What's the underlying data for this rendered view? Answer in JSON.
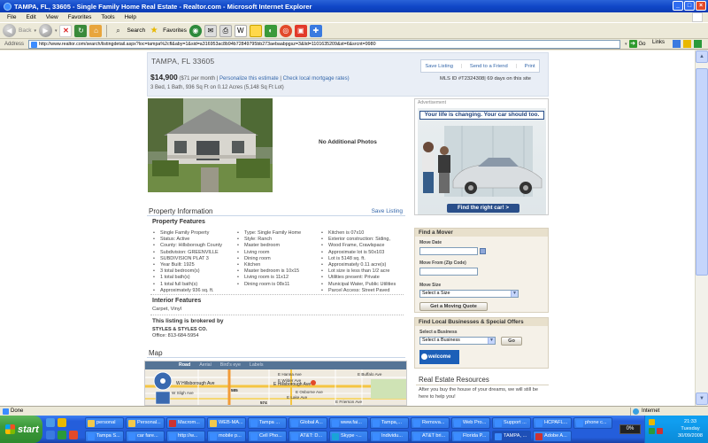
{
  "window": {
    "title": "TAMPA, FL, 33605 - Single Family Home Real Estate - Realtor.com - Microsoft Internet Explorer"
  },
  "menu": [
    "File",
    "Edit",
    "View",
    "Favorites",
    "Tools",
    "Help"
  ],
  "toolbar": {
    "back_label": "Back",
    "search_label": "Search",
    "favorites_label": "Favorites"
  },
  "address": {
    "label": "Address",
    "url": "http://www.realtor.com/search/listingdetail.aspx?loc=tampa%2cfl&aby=1&sid=a316953ac8b94b72849795bb273aebaabpgsz=3&lid=1101635209&st=6&srcnt=9980",
    "go_label": "Go",
    "links_label": "Links"
  },
  "listing": {
    "location": "TAMPA, FL 33605",
    "price": "$14,900",
    "per_month": "($71 per month |",
    "personalize_link": "Personalize this estimate",
    "sep": "|",
    "mortgage_link": "Check local mortgage rates)",
    "details": "3 Bed, 1 Bath, 936 Sq Ft on 0.12 Acres (5,148 Sq Ft Lot)",
    "actions": [
      "Save Listing",
      "Send to a Friend",
      "Print"
    ],
    "mls": "MLS ID #T2324308| 69 days on this site",
    "no_photos": "No Additional Photos"
  },
  "property_info": {
    "title": "Property Information",
    "save_link": "Save Listing",
    "features_title": "Property Features",
    "col1": [
      "Single Family Property",
      "Status: Active",
      "County: Hillsborough County",
      "Subdivision: GREENVILLE",
      "SUBDIVISION PLAT 3",
      "Year Built: 1925",
      "3 total bedroom(s)",
      "1 total bath(s)",
      "1 total full bath(s)",
      "Approximately 936 sq. ft."
    ],
    "col2": [
      "Type: Single Family Home",
      "Style: Ranch",
      "Master bedroom",
      "Living room",
      "Dining room",
      "Kitchen",
      "Master bedroom is 10x15",
      "Living room is 11x12",
      "Dining room is 08x11"
    ],
    "col3": [
      "Kitchen is 07x10",
      "Exterior construction: Siding,",
      "Wood Frame, Crawlspace",
      "Approximate lot is 50x103",
      "Lot is 5148 sq. ft.",
      "Approximately 0.11 acre(s)",
      "Lot size is less than 1/2 acre",
      "Utilities present: Private",
      "Municipal Water, Public Utilities",
      "Parcel Access: Street Paved"
    ],
    "interior_title": "Interior Features",
    "interior_value": "Carpet, Vinyl",
    "broker_title": "This listing is brokered by",
    "broker_name": "STYLES & STYLES CO.",
    "broker_office": "Office: 813-684-5954"
  },
  "map": {
    "title": "Map",
    "tabs": [
      "Road",
      "Aerial",
      "Bird's eye",
      "Labels"
    ],
    "labels": [
      "E Hanna Ave",
      "E Wilder Ave",
      "W Hillsborough Ave",
      "E Hillsborough Ave",
      "E Osborne Ave",
      "E Lake Ave",
      "W Sligh Ave",
      "E Frierson Ave",
      "E Buffalo Ave",
      "585",
      "574"
    ]
  },
  "ad": {
    "label": "Advertisement",
    "headline": "Your life is changing. Your car should too.",
    "button": "Find the right car! >"
  },
  "mover": {
    "title": "Find a Mover",
    "move_date_label": "Move Date",
    "move_from_label": "Move From (Zip Code)",
    "move_size_label": "Move Size",
    "move_size_value": "Select a Size",
    "quote_button": "Get a Moving Quote"
  },
  "local": {
    "title": "Find Local Businesses & Special Offers",
    "select_label": "Select a Business",
    "select_value": "Select a Business",
    "go_button": "Go",
    "welcome": "welcome wagon"
  },
  "resources": {
    "title": "Real Estate Resources",
    "text": "After you buy the house of your dreams, we will still be here to help you!"
  },
  "status": {
    "left": "Done",
    "zone": "Internet"
  },
  "taskbar": {
    "start": "start",
    "row1": [
      "personal",
      "Personal...",
      "Macrom...",
      "WEB-MA...",
      "Tampa ...",
      "Global A...",
      "www.fai...",
      "Tampa,...",
      "Remova...",
      "Web Pro...",
      "Support ...",
      "HCPAFL...",
      "phone c..."
    ],
    "row2": [
      "Tampa S...",
      "car fare...",
      "http://w...",
      "mobile p...",
      "Cell Pho...",
      "AT&T: D...",
      "Skype -...",
      "Individu...",
      "AT&T bri...",
      "Florida P...",
      "TAMPA, ...",
      "Adobe A..."
    ],
    "percent": "0%",
    "time": "21:33",
    "day": "Tuesday",
    "date": "30/09/2008"
  }
}
